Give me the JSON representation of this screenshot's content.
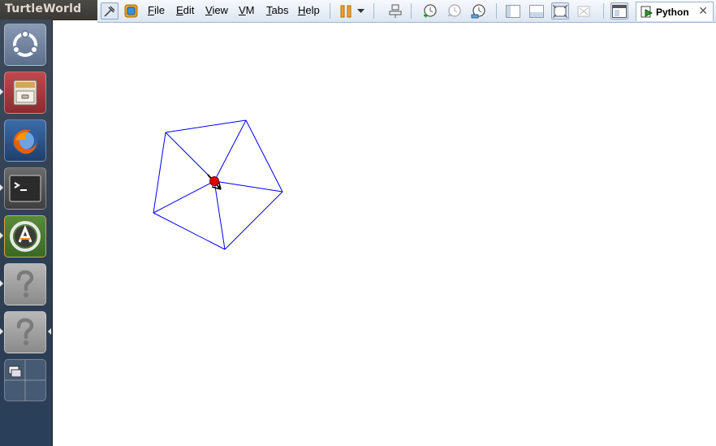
{
  "panel": {
    "app_title": "TurtleWorld"
  },
  "toolbar": {
    "menus": [
      "File",
      "Edit",
      "View",
      "VM",
      "Tabs",
      "Help"
    ],
    "menu_mnemonics": [
      "F",
      "E",
      "V",
      "V",
      "T",
      "H"
    ]
  },
  "tab": {
    "label": "Python",
    "close": "✕"
  },
  "launcher": {
    "items": [
      "ubuntu-dash",
      "files",
      "firefox",
      "terminal",
      "software-updater",
      "unknown-app",
      "unknown-app",
      "workspace-switcher"
    ]
  },
  "colors": {
    "polygon_stroke": "#0000ff",
    "turtle_fill": "#e00000",
    "launcher_bg": "#2e3e52",
    "toolbar_bg": "#dce6f2"
  }
}
